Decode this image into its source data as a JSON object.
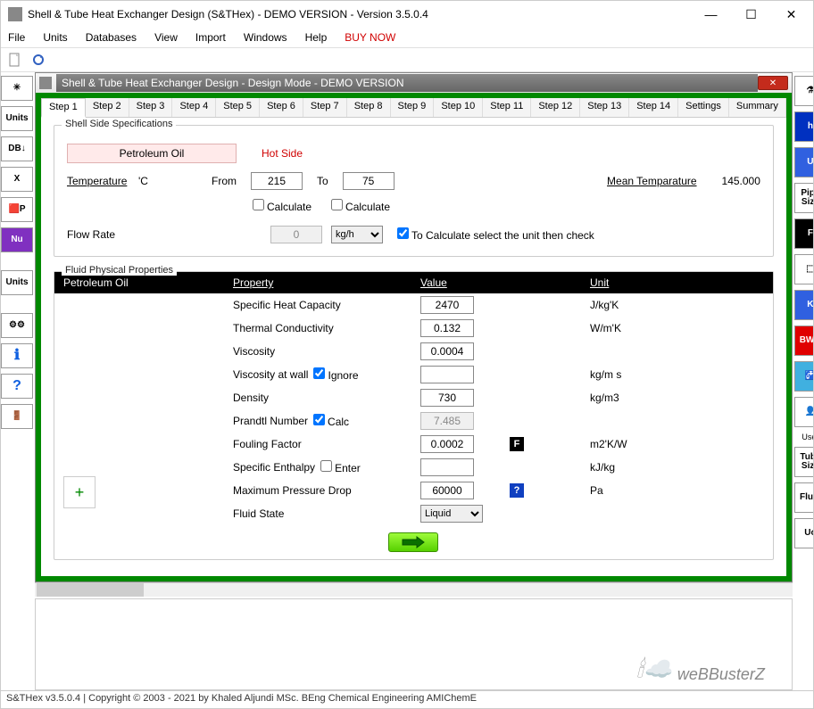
{
  "titlebar": "Shell & Tube Heat Exchanger Design (S&THex) - DEMO VERSION - Version 3.5.0.4",
  "menu": [
    "File",
    "Units",
    "Databases",
    "View",
    "Import",
    "Windows",
    "Help",
    "BUY NOW"
  ],
  "leftTools": [
    {
      "name": "new-file",
      "text": "✳"
    },
    {
      "name": "units-tool",
      "text": "Units"
    },
    {
      "name": "db-down",
      "text": "DB↓"
    },
    {
      "name": "excel-tool",
      "text": "X"
    },
    {
      "name": "ip-tool",
      "text": "🟥P"
    },
    {
      "name": "nu-tool",
      "text": "Nu"
    },
    {
      "name": "units-bar",
      "text": "Units"
    },
    {
      "name": "gears-tool",
      "text": "⚙⚙"
    },
    {
      "name": "info-tool",
      "text": "ℹ"
    },
    {
      "name": "help-tool",
      "text": "?"
    },
    {
      "name": "exit-tool",
      "text": "🚪"
    }
  ],
  "rightTools": [
    {
      "name": "flask-tool",
      "text": "⚗",
      "bg": "#fff"
    },
    {
      "name": "h-tool",
      "text": "h",
      "bg": "#0030c0",
      "fg": "#fff"
    },
    {
      "name": "u-tool",
      "text": "U",
      "bg": "#3060e0",
      "fg": "#fff"
    },
    {
      "name": "pipe-size",
      "text": "Pipe\nSize",
      "bg": "#fff"
    },
    {
      "name": "f-tool",
      "text": "F",
      "bg": "#000",
      "fg": "#fff"
    },
    {
      "name": "pattern-tool",
      "text": "⬚",
      "bg": "#fff"
    },
    {
      "name": "k-tool",
      "text": "K",
      "bg": "#3060e0",
      "fg": "#fff"
    },
    {
      "name": "bwg-tool",
      "text": "BWG",
      "bg": "#e00000",
      "fg": "#fff"
    },
    {
      "name": "tap-tool",
      "text": "🚰",
      "bg": "#40b0e0"
    },
    {
      "name": "user-tool",
      "text": "👤",
      "label": "User"
    },
    {
      "name": "tube-size",
      "text": "Tube\nSize"
    },
    {
      "name": "fluid-tool",
      "text": "Fluid"
    },
    {
      "name": "uo-tool",
      "text": "Uo"
    }
  ],
  "docTitle": "Shell & Tube Heat Exchanger Design - Design Mode - DEMO VERSION",
  "tabs": [
    "Step 1",
    "Step 2",
    "Step 3",
    "Step 4",
    "Step 5",
    "Step 6",
    "Step 7",
    "Step 8",
    "Step 9",
    "Step 10",
    "Step 11",
    "Step 12",
    "Step 13",
    "Step 14",
    "Settings",
    "Summary"
  ],
  "shell": {
    "group": "Shell Side Specifications",
    "fluid": "Petroleum Oil",
    "hotside": "Hot Side",
    "tempLabel": "Temperature",
    "tempUnit": "'C",
    "from": "From",
    "fromVal": "215",
    "to": "To",
    "toVal": "75",
    "calc": "Calculate",
    "meanLabel": "Mean Temparature",
    "meanVal": "145.000",
    "flowLabel": "Flow Rate",
    "flowVal": "0",
    "flowUnit": "kg/h",
    "flowNote": "To Calculate select the unit then check"
  },
  "props": {
    "group": "Fluid Physical Properties",
    "header": {
      "c1": "Petroleum Oil",
      "c2": "Property",
      "c3": "Value",
      "c4": "Unit"
    },
    "rows": [
      {
        "p": "Specific Heat Capacity",
        "v": "2470",
        "u": "J/kg'K"
      },
      {
        "p": "Thermal Conductivity",
        "v": "0.132",
        "u": "W/m'K"
      },
      {
        "p": "Viscosity",
        "v": "0.0004",
        "u": ""
      },
      {
        "p": "Viscosity at wall",
        "chk": "Ignore",
        "v": "",
        "u": "kg/m s"
      },
      {
        "p": "Density",
        "v": "730",
        "u": "kg/m3"
      },
      {
        "p": "Prandtl Number",
        "chk": "Calc",
        "v": "7.485",
        "ro": true,
        "u": ""
      },
      {
        "p": "Fouling Factor",
        "v": "0.0002",
        "badge": "F",
        "u": "m2'K/W"
      },
      {
        "p": "Specific Enthalpy",
        "chk": "Enter",
        "v": "",
        "u": "kJ/kg"
      },
      {
        "p": "Maximum Pressure Drop",
        "v": "60000",
        "badge": "?",
        "u": "Pa"
      },
      {
        "p": "Fluid State",
        "select": "Liquid",
        "u": ""
      }
    ]
  },
  "watermark": "weBBusterZ",
  "status": "S&THex  v3.5.0.4  |  Copyright © 2003 - 2021 by Khaled Aljundi MSc. BEng Chemical Engineering AMIChemE"
}
